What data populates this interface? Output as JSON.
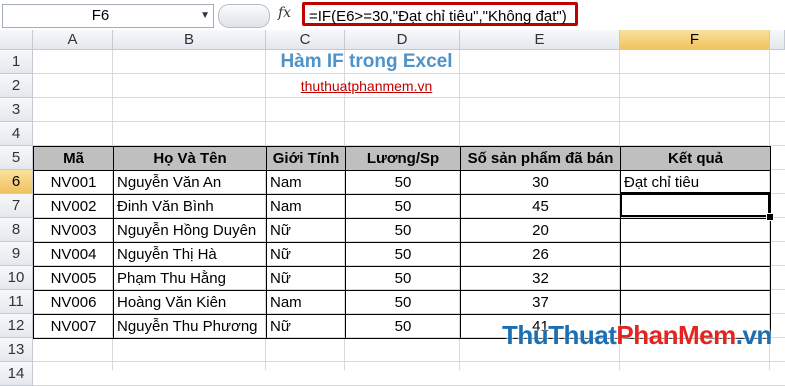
{
  "name_box": "F6",
  "fx_label": "fx",
  "formula": "=IF(E6>=30,\"Đạt chỉ tiêu\",\"Không đạt\")",
  "columns": [
    "A",
    "B",
    "C",
    "D",
    "E",
    "F"
  ],
  "rows": [
    "1",
    "2",
    "3",
    "4",
    "5",
    "6",
    "7",
    "8",
    "9",
    "10",
    "11",
    "12",
    "13",
    "14"
  ],
  "title": "Hàm IF trong Excel",
  "subtitle": "thuthuatphanmem.vn",
  "headers": [
    "Mã",
    "Họ Và Tên",
    "Giới Tính",
    "Lương/Sp",
    "Số sản phẩm đã bán",
    "Kết quả"
  ],
  "data": [
    [
      "NV001",
      "Nguyễn Văn An",
      "Nam",
      "50",
      "30",
      "Đạt chỉ tiêu"
    ],
    [
      "NV002",
      "Đinh Văn Bình",
      "Nam",
      "50",
      "45",
      ""
    ],
    [
      "NV003",
      "Nguyễn Hồng Duyên",
      "Nữ",
      "50",
      "20",
      ""
    ],
    [
      "NV004",
      "Nguyễn Thị Hà",
      "Nữ",
      "50",
      "26",
      ""
    ],
    [
      "NV005",
      "Phạm Thu Hằng",
      "Nữ",
      "50",
      "32",
      ""
    ],
    [
      "NV006",
      "Hoàng Văn Kiên",
      "Nam",
      "50",
      "37",
      ""
    ],
    [
      "NV007",
      "Nguyễn Thu Phương",
      "Nữ",
      "50",
      "41",
      ""
    ]
  ],
  "watermark": {
    "part1": "ThuThuat",
    "part2": "PhanMem",
    "part3": ".vn"
  },
  "colors": {
    "title": "#4f93c9",
    "subtitle": "#c00000",
    "header_bg": "#bfbfbf",
    "formula_border": "#c00000",
    "wm1": "#1a6fb5",
    "wm2": "#e52421"
  }
}
